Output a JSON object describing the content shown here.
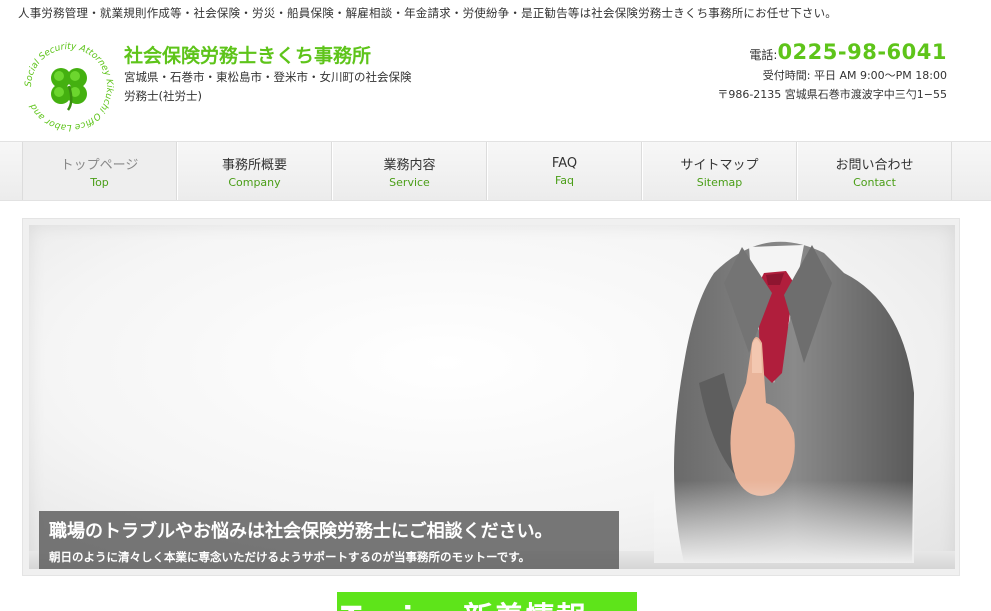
{
  "header": {
    "tagline": "人事労務管理・就業規則作成等・社会保険・労災・船員保険・解雇相談・年金請求・労使紛争・是正勧告等は社会保険労務士きくち事務所にお任せ下さい。",
    "site_title": "社会保険労務士きくち事務所",
    "site_description": "宮城県・石巻市・東松島市・登米市・女川町の社会保険労務士(社労士)",
    "logo_ring_text": "Social Security Attorney Kikuchi Office Labor and",
    "phone_label": "電話:",
    "phone_number": "0225-98-6041",
    "hours": "受付時間: 平日 AM 9:00〜PM 18:00",
    "address": "〒986-2135 宮城県石巻市渡波字中三勺1−55"
  },
  "nav": {
    "items": [
      {
        "ja": "トップページ",
        "en": "Top"
      },
      {
        "ja": "事務所概要",
        "en": "Company"
      },
      {
        "ja": "業務内容",
        "en": "Service"
      },
      {
        "ja": "FAQ",
        "en": "Faq"
      },
      {
        "ja": "サイトマップ",
        "en": "Sitemap"
      },
      {
        "ja": "お問い合わせ",
        "en": "Contact"
      }
    ]
  },
  "hero": {
    "title": "職場のトラブルやお悩みは社会保険労務士にご相談ください。",
    "subtitle": "朝日のように清々しく本業に専念いただけるようサポートするのが当事務所のモットーです。"
  },
  "topics": {
    "heading": "Topics 新着情報"
  },
  "colors": {
    "brand_green": "#5ec41a",
    "nav_en_green": "#4a9e17",
    "topics_green": "#5ee41a"
  }
}
